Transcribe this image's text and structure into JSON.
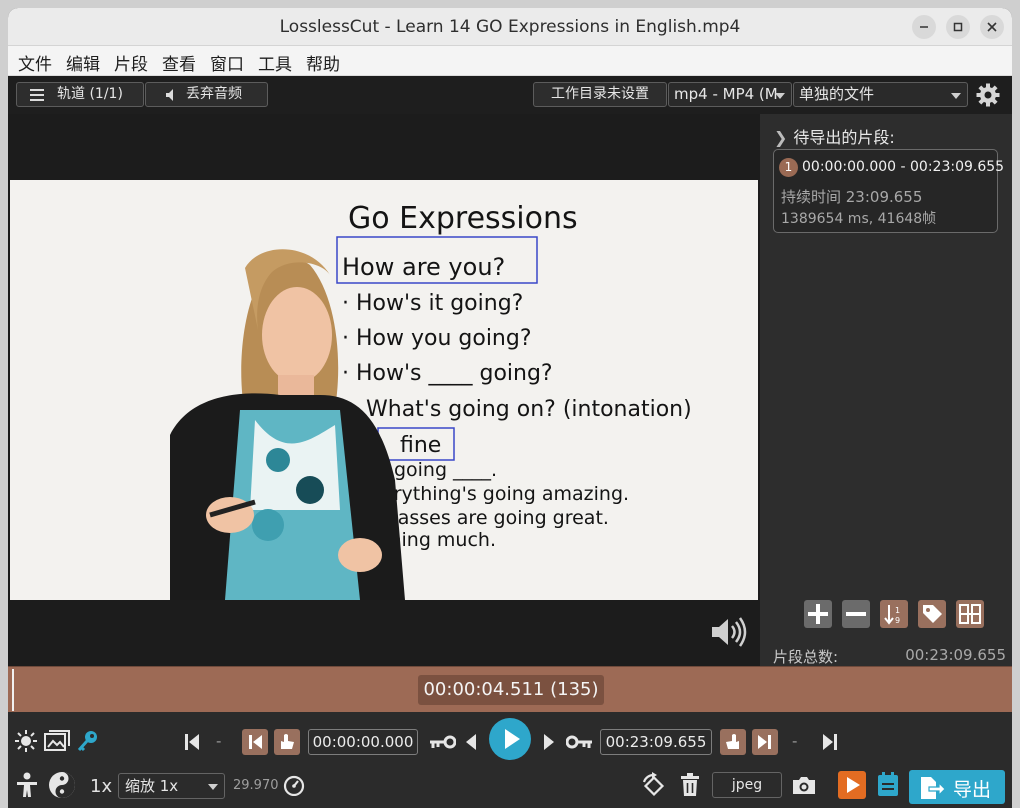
{
  "window": {
    "title": "LosslessCut - Learn 14 GO Expressions in English.mp4"
  },
  "menu": {
    "items": [
      "文件",
      "编辑",
      "片段",
      "查看",
      "窗口",
      "工具",
      "帮助"
    ]
  },
  "toolbar": {
    "tracks_label": "轨道 (1/1)",
    "discard_audio_label": "丢弃音频",
    "workdir_label": "工作目录未设置",
    "format_value": "mp4 - MP4 (M",
    "output_mode_value": "单独的文件"
  },
  "video": {
    "whiteboard": {
      "title": "Go Expressions",
      "lines": [
        "How are you?",
        "· How's it going?",
        "· How you going?",
        "· How's ____ going?",
        "What's going on? (intonation)",
        "fine",
        "s going ____.",
        "erything's going amazing.",
        "classes are going great.",
        "thing much."
      ]
    }
  },
  "segments": {
    "header": "待导出的片段:",
    "items": [
      {
        "index": "1",
        "range": "00:00:00.000 - 00:23:09.655",
        "duration": "持续时间 23:09.655",
        "detail": "1389654 ms, 41648帧"
      }
    ],
    "total_label": "片段总数:",
    "total_value": "00:23:09.655"
  },
  "timeline": {
    "current_time": "00:00:04.511 (135)"
  },
  "controls": {
    "dash_left": "-",
    "cut_start": "00:00:00.000",
    "cut_end": "00:23:09.655",
    "dash_right": "-",
    "speed": "1x",
    "zoom_value": "缩放 1x",
    "fps": "29.970",
    "capture_format": "jpeg",
    "export_label": "导出"
  },
  "colors": {
    "accent": "#2ea7cb",
    "segment": "#9d6a55",
    "panel": "#2b2b2b"
  }
}
